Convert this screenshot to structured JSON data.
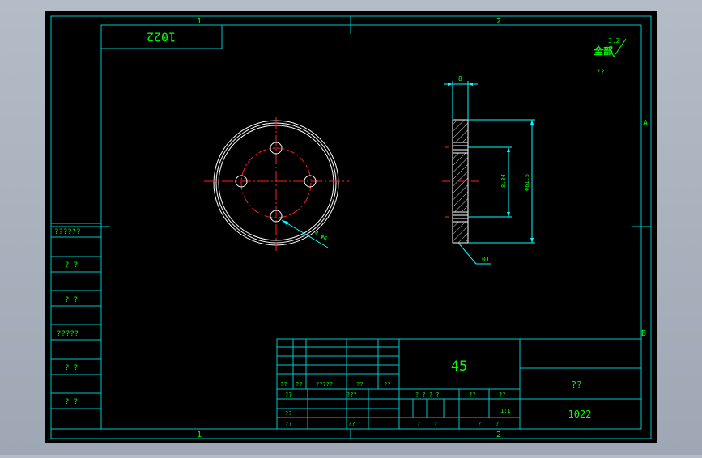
{
  "colors": {
    "background": "#000000",
    "frame": "#00c8c8",
    "text": "#00ff00",
    "part": "#ffffff",
    "centerline": "#ff2020",
    "dimension": "#00ffff",
    "hatch": "#ffffff"
  },
  "zone_labels": {
    "col_1_top": "1",
    "col_2_top": "2",
    "col_1_bottom": "1",
    "col_2_bottom": "2",
    "row_a": "A",
    "row_b": "B"
  },
  "drawing_number_rotated": "1022",
  "roughness": {
    "label": "全部",
    "value": "3.2",
    "note": "??"
  },
  "dimensions": {
    "thickness": "8",
    "hole_pitch": "8.34",
    "outer_diameter": "Φ61.5",
    "hole_callout": "4-Φ6",
    "part_leader": "01"
  },
  "left_strip": {
    "labels": [
      "??????",
      "? ?",
      "? ?",
      "?????",
      "? ?",
      "? ?"
    ]
  },
  "title_block": {
    "material": "45",
    "name": "??",
    "drawing_number": "1022",
    "revision_row": [
      "??",
      "??",
      "?????",
      "??",
      "??"
    ],
    "sign_rows": [
      {
        "a": "??",
        "b": "???"
      },
      {
        "a": "??",
        "b": ""
      },
      {
        "a": "??",
        "b": "??"
      }
    ],
    "stage_header": "? ? ? ?",
    "weight_header": "??",
    "scale_header": "??",
    "scale_value": "1:1",
    "sheet_row": [
      "?",
      "?",
      "?",
      "?"
    ]
  }
}
